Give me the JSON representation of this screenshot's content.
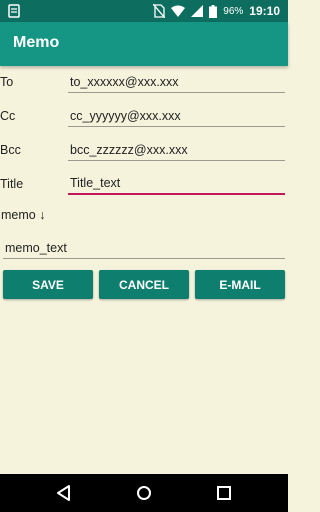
{
  "status_bar": {
    "battery_percent": "96%",
    "time": "19:10",
    "icons": [
      "notification-icon",
      "no-sim-icon",
      "wifi-icon",
      "signal-icon",
      "battery-icon"
    ]
  },
  "app_bar": {
    "title": "Memo"
  },
  "form": {
    "to": {
      "label": "To",
      "value": "to_xxxxxx@xxx.xxx"
    },
    "cc": {
      "label": "Cc",
      "value": "cc_yyyyyy@xxx.xxx"
    },
    "bcc": {
      "label": "Bcc",
      "value": "bcc_zzzzzz@xxx.xxx"
    },
    "title": {
      "label": "Title",
      "value": "Title_text"
    },
    "memo": {
      "label": "memo ↓",
      "value": "memo_text"
    }
  },
  "buttons": {
    "save": "SAVE",
    "cancel": "CANCEL",
    "email": "E-MAIL"
  },
  "nav": {
    "icons": [
      "back-icon",
      "home-icon",
      "recents-icon"
    ]
  },
  "colors": {
    "status_bar": "#0d6e60",
    "app_bar": "#159584",
    "button": "#0e7f6e",
    "background": "#f5f3dc",
    "focus_underline": "#c2185b"
  }
}
